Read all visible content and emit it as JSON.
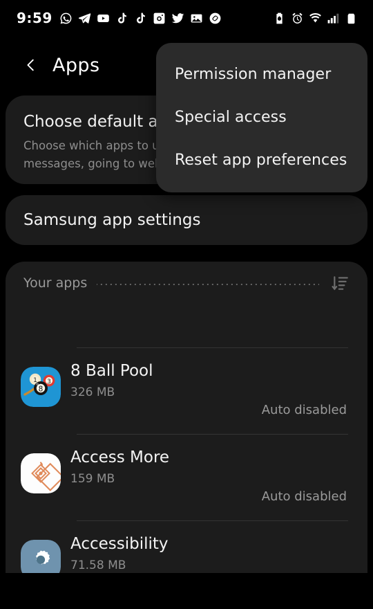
{
  "statusbar": {
    "time": "9:59",
    "notification_icons": [
      {
        "name": "whatsapp-icon"
      },
      {
        "name": "telegram-icon"
      },
      {
        "name": "youtube-icon"
      },
      {
        "name": "tiktok-icon"
      },
      {
        "name": "tiktok-icon-2"
      },
      {
        "name": "instagram-icon"
      },
      {
        "name": "twitter-icon"
      },
      {
        "name": "gallery-icon"
      },
      {
        "name": "shazam-icon"
      }
    ],
    "system_icons": [
      {
        "name": "battery-saver-icon"
      },
      {
        "name": "alarm-icon"
      },
      {
        "name": "wifi-icon"
      },
      {
        "name": "signal-icon"
      },
      {
        "name": "battery-icon"
      }
    ]
  },
  "actionbar": {
    "back_icon": "back-chevron-icon",
    "title": "Apps"
  },
  "menu": {
    "items": [
      {
        "label": "Permission manager"
      },
      {
        "label": "Special access"
      },
      {
        "label": "Reset app preferences"
      }
    ]
  },
  "cards": {
    "default_apps": {
      "title": "Choose default apps",
      "subtitle_line1": "Choose which apps to use for making calls, sending",
      "subtitle_line2": "messages, going to websites, and more."
    },
    "samsung_app_settings": {
      "title": "Samsung app settings"
    }
  },
  "your_apps": {
    "label": "Your apps",
    "sort_icon": "sort-descending-icon",
    "apps": [
      {
        "name": "8 Ball Pool",
        "size": "326 MB",
        "status": "Auto disabled",
        "icon": "8-ball-pool-icon",
        "icon_bg": "#2196d8"
      },
      {
        "name": "Access More",
        "size": "159 MB",
        "status": "Auto disabled",
        "icon": "access-more-icon",
        "icon_bg": "#ffffff"
      },
      {
        "name": "Accessibility",
        "size": "71.58 MB",
        "status": "",
        "icon": "accessibility-gear-icon",
        "icon_bg": "#6f93ae"
      }
    ]
  },
  "colors": {
    "background": "#000000",
    "card": "#1c1c1c",
    "menu": "#2b2b2b",
    "text_primary": "#f3f3f3",
    "text_secondary": "#8e8e8e",
    "divider": "#343434"
  }
}
